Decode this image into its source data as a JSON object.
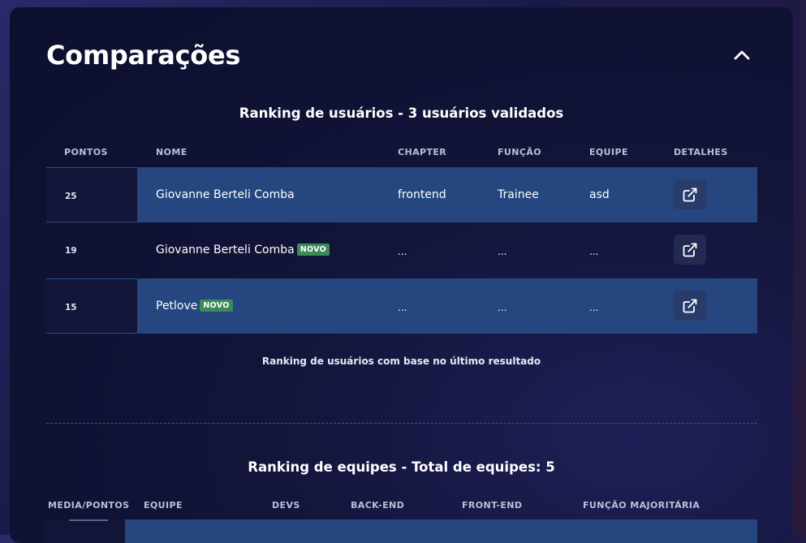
{
  "panel": {
    "title": "Comparações",
    "collapse_icon": "chevron-up-icon"
  },
  "users_ranking": {
    "title": "Ranking de usuários - 3 usuários validados",
    "columns": [
      "PONTOS",
      "NOME",
      "CHAPTER",
      "FUNÇÃO",
      "EQUIPE",
      "DETALHES"
    ],
    "rows": [
      {
        "points": "25",
        "name": "Giovanne Berteli Comba",
        "badge": "",
        "chapter": "frontend",
        "role": "Trainee",
        "team": "asd",
        "highlight": true
      },
      {
        "points": "19",
        "name": "Giovanne Berteli Comba",
        "badge": "NOVO",
        "chapter": "...",
        "role": "...",
        "team": "...",
        "highlight": false
      },
      {
        "points": "15",
        "name": "Petlove",
        "badge": "NOVO",
        "chapter": "...",
        "role": "...",
        "team": "...",
        "highlight": true
      }
    ],
    "detail_icon": "external-link-icon",
    "footnote": "Ranking de usuários com base no último resultado"
  },
  "teams_ranking": {
    "title": "Ranking de equipes - Total de equipes: 5",
    "columns": [
      "MEDIA/PONTOS",
      "EQUIPE",
      "DEVS",
      "BACK-END",
      "FRONT-END",
      "FUNÇÃO MAJORITÁRIA"
    ]
  },
  "colors": {
    "panel_bg": "#0d0f2e",
    "row_highlight": "#25467e",
    "badge_bg": "#3a8a5a",
    "detail_button_bg": "#283b6a"
  }
}
